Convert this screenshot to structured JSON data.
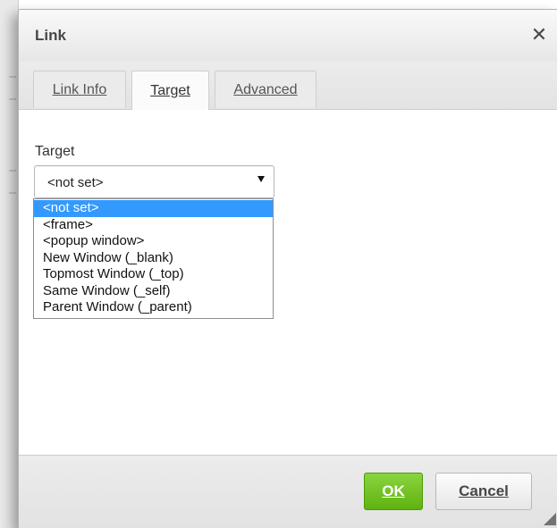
{
  "dialog": {
    "title": "Link",
    "close_icon": "close-icon"
  },
  "tabs": [
    {
      "label": "Link Info",
      "active": false
    },
    {
      "label": "Target",
      "active": true
    },
    {
      "label": "Advanced",
      "active": false
    }
  ],
  "target": {
    "label": "Target",
    "selected_value": "<not set>",
    "options": [
      "<not set>",
      "<frame>",
      "<popup window>",
      "New Window (_blank)",
      "Topmost Window (_top)",
      "Same Window (_self)",
      "Parent Window (_parent)"
    ],
    "highlighted_index": 0,
    "highlight_color": "#3399ff"
  },
  "footer": {
    "ok_label": "OK",
    "cancel_label": "Cancel",
    "ok_color": "#6cc224"
  }
}
